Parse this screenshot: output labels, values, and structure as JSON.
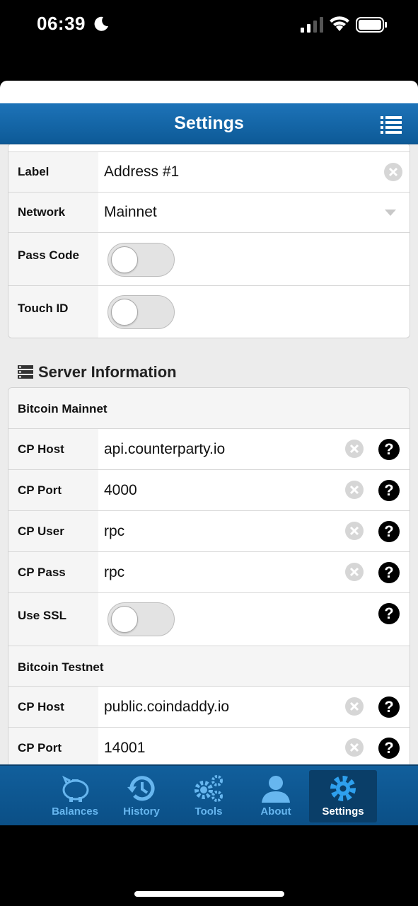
{
  "status_bar": {
    "time": "06:39"
  },
  "nav": {
    "title": "Settings",
    "menu_icon": "list-icon"
  },
  "address": {
    "label": {
      "name": "Label",
      "value": "Address #1"
    },
    "network": {
      "name": "Network",
      "value": "Mainnet"
    },
    "pass_code": {
      "name": "Pass Code",
      "enabled": false
    },
    "touch_id": {
      "name": "Touch ID",
      "enabled": false
    }
  },
  "server": {
    "title": "Server Information",
    "icon": "server-icon",
    "mainnet": {
      "title": "Bitcoin Mainnet",
      "host": {
        "name": "CP Host",
        "value": "api.counterparty.io"
      },
      "port": {
        "name": "CP Port",
        "value": "4000"
      },
      "user": {
        "name": "CP User",
        "value": "rpc"
      },
      "pass": {
        "name": "CP Pass",
        "value": "rpc"
      },
      "ssl": {
        "name": "Use SSL",
        "enabled": false
      }
    },
    "testnet": {
      "title": "Bitcoin Testnet",
      "host": {
        "name": "CP Host",
        "value": "public.coindaddy.io"
      },
      "port": {
        "name": "CP Port",
        "value": "14001"
      }
    }
  },
  "tabs": [
    {
      "label": "Balances",
      "icon": "piggy-bank-icon"
    },
    {
      "label": "History",
      "icon": "history-icon"
    },
    {
      "label": "Tools",
      "icon": "gears-icon"
    },
    {
      "label": "About",
      "icon": "user-icon"
    },
    {
      "label": "Settings",
      "icon": "gear-icon",
      "active": true
    }
  ],
  "colors": {
    "nav_blue": "#1d73b8",
    "tab_blue": "#0b4f86",
    "tab_text": "#67b6ef"
  }
}
